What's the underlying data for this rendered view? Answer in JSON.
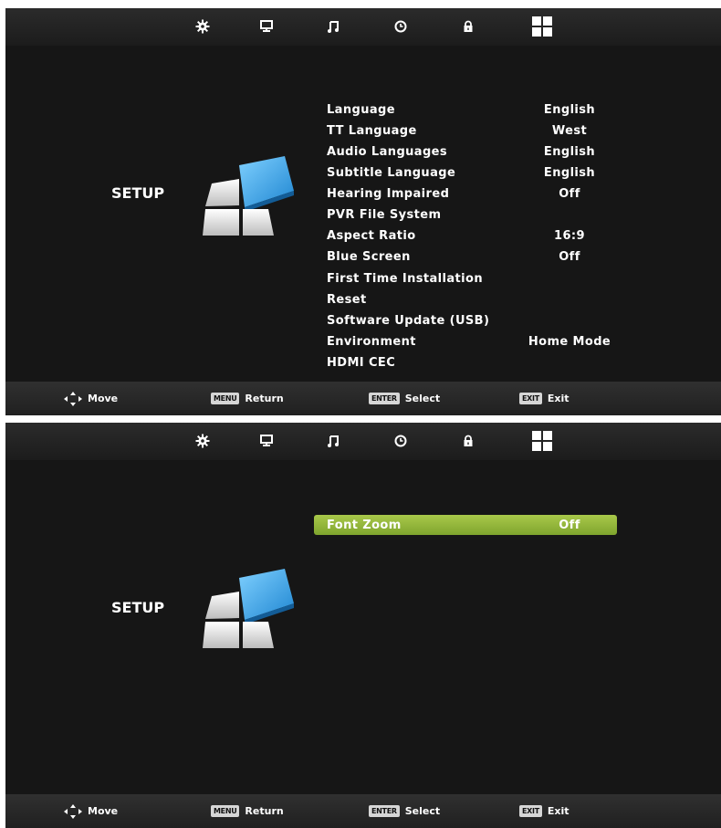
{
  "screens": [
    {
      "title": "SETUP",
      "menu_items": [
        {
          "label": "Language",
          "value": "English"
        },
        {
          "label": "TT Language",
          "value": "West"
        },
        {
          "label": "Audio Languages",
          "value": "English"
        },
        {
          "label": "Subtitle Language",
          "value": "English"
        },
        {
          "label": "Hearing Impaired",
          "value": "Off"
        },
        {
          "label": "PVR File System",
          "value": ""
        },
        {
          "label": "Aspect Ratio",
          "value": "16:9"
        },
        {
          "label": "Blue Screen",
          "value": "Off"
        },
        {
          "label": "First Time Installation",
          "value": ""
        },
        {
          "label": "Reset",
          "value": ""
        },
        {
          "label": "Software Update (USB)",
          "value": ""
        },
        {
          "label": "Environment",
          "value": "Home Mode"
        },
        {
          "label": "HDMI CEC",
          "value": ""
        }
      ]
    },
    {
      "title": "SETUP",
      "menu_items": [
        {
          "label": "Font Zoom",
          "value": "Off",
          "selected": true
        }
      ]
    }
  ],
  "top_tabs": [
    "gear-icon",
    "monitor-icon",
    "music-note-icon",
    "clock-icon",
    "lock-icon",
    "grid-icon"
  ],
  "hints": {
    "move": "Move",
    "menu_key": "MENU",
    "return": "Return",
    "enter_key": "ENTER",
    "select": "Select",
    "exit_key": "EXIT",
    "exit": "Exit"
  },
  "colors": {
    "background": "#161616",
    "selected_highlight": "#a9c84a",
    "icon_blue": "#2e9be0"
  }
}
